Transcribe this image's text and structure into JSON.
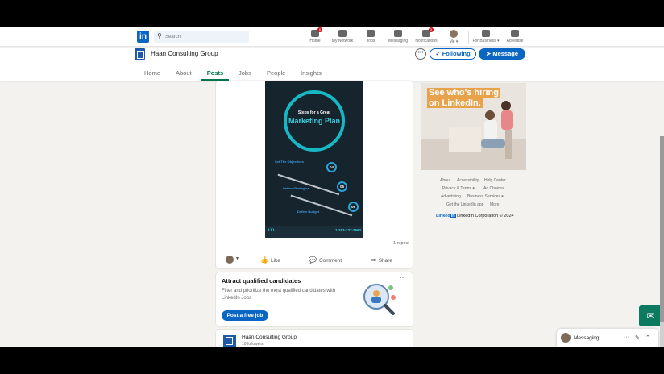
{
  "nav": {
    "search_placeholder": "Search",
    "items": [
      {
        "label": "Home",
        "badge": "6"
      },
      {
        "label": "My Network",
        "badge": ""
      },
      {
        "label": "Jobs",
        "badge": ""
      },
      {
        "label": "Messaging",
        "badge": ""
      },
      {
        "label": "Notifications",
        "badge": "3"
      },
      {
        "label": "Me",
        "badge": ""
      },
      {
        "label": "For Business",
        "badge": ""
      },
      {
        "label": "Advertise",
        "badge": ""
      }
    ]
  },
  "company": {
    "name": "Haan Consulting Group",
    "following_label": "Following",
    "message_label": "Message",
    "tabs": [
      "Home",
      "About",
      "Posts",
      "Jobs",
      "People",
      "Insights"
    ],
    "active_tab": "Posts"
  },
  "post": {
    "poster_title": "Steps for a Great",
    "poster_main": "Marketing Plan",
    "steps": [
      "04",
      "05",
      "06"
    ],
    "step_labels": [
      "Set The Objectives",
      "Define Strategies",
      "Define Budget"
    ],
    "phone": "1-263-237-3963",
    "repost_count": "1 repost",
    "actions": [
      "Like",
      "Comment",
      "Share"
    ]
  },
  "candidates": {
    "title": "Attract qualified candidates",
    "description": "Filter and prioritize the most qualified candidates with LinkedIn Jobs",
    "button": "Post a free job"
  },
  "next_post": {
    "company": "Haan Consulting Group",
    "followers": "10 followers"
  },
  "ad": {
    "line1": "See who's hiring",
    "line2": "on LinkedIn."
  },
  "footer": {
    "row1": [
      "About",
      "Accessibility",
      "Help Center"
    ],
    "row2": [
      "Privacy & Terms",
      "Ad Choices"
    ],
    "row3": [
      "Advertising",
      "Business Services"
    ],
    "row4": [
      "Get the LinkedIn app",
      "More"
    ],
    "brand": "Linked",
    "brand_in": "in",
    "copyright": "LinkedIn Corporation © 2024"
  },
  "messaging": {
    "label": "Messaging"
  },
  "colors": {
    "brand_blue": "#0a66c2",
    "active_green": "#01754f"
  }
}
